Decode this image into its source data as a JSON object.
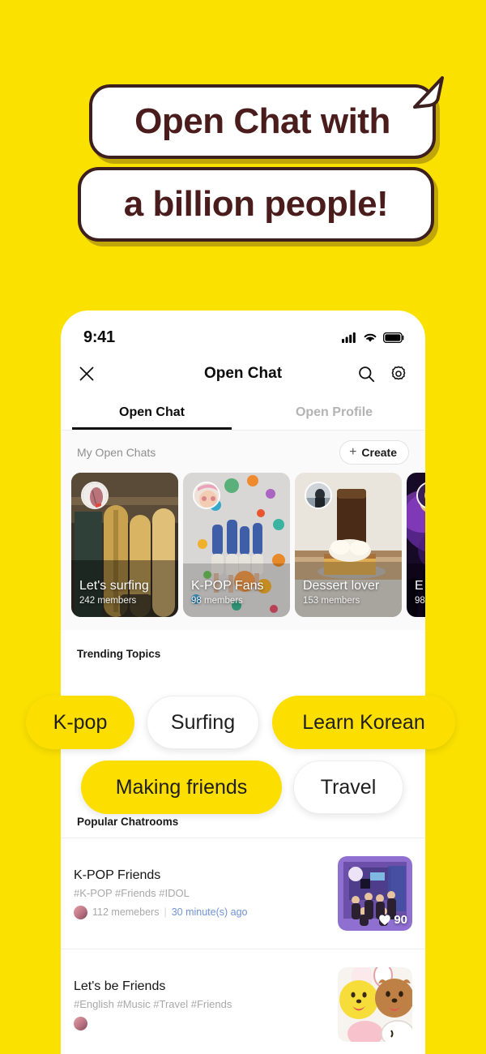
{
  "theme": {
    "background": "#FAE100",
    "brand_yellow": "#FCDE00",
    "bubble_text": "#4A1C1C",
    "bubble_border": "#3D1F1F",
    "link_blue": "#6F93D6"
  },
  "hero": {
    "line1": "Open Chat with",
    "line2": "a billion people!"
  },
  "phone": {
    "status_bar": {
      "time": "9:41",
      "icons": [
        "cellular-signal-icon",
        "wifi-icon",
        "battery-icon"
      ]
    },
    "navbar": {
      "close_label": "close-icon",
      "title": "Open Chat",
      "search_label": "search-icon",
      "settings_label": "gear-icon"
    },
    "tabs": [
      {
        "label": "Open Chat",
        "active": true
      },
      {
        "label": "Open Profile",
        "active": false
      }
    ],
    "my_open_chats": {
      "label": "My Open Chats",
      "create_label": "Create",
      "create_plus": "+",
      "cards": [
        {
          "title": "Let's surfing",
          "members": "242 members",
          "has_avatar": true
        },
        {
          "title": "K-POP Fans",
          "members": "98 members",
          "has_avatar": true
        },
        {
          "title": "Dessert lover",
          "members": "153 members",
          "has_avatar": true
        },
        {
          "title": "E",
          "members": "98",
          "has_avatar": true
        }
      ]
    },
    "trending": {
      "heading": "Trending Topics",
      "topics": [
        {
          "label": "K-pop",
          "selected": true
        },
        {
          "label": "Surfing",
          "selected": false
        },
        {
          "label": "Learn Korean",
          "selected": true
        },
        {
          "label": "Making friends",
          "selected": true
        },
        {
          "label": "Travel",
          "selected": false
        }
      ]
    },
    "popular": {
      "heading": "Popular Chatrooms",
      "rooms": [
        {
          "title": "K-POP Friends",
          "tags": "#K-POP #Friends #IDOL",
          "members": "112 memebers",
          "separator": "|",
          "time": "30 minute(s) ago",
          "likes": "90",
          "like_icon": "heart-icon"
        },
        {
          "title": "Let's be Friends",
          "tags": "#English #Music #Travel #Friends",
          "members": "",
          "separator": "",
          "time": "",
          "likes": "",
          "like_icon": "heart-icon"
        }
      ]
    }
  }
}
